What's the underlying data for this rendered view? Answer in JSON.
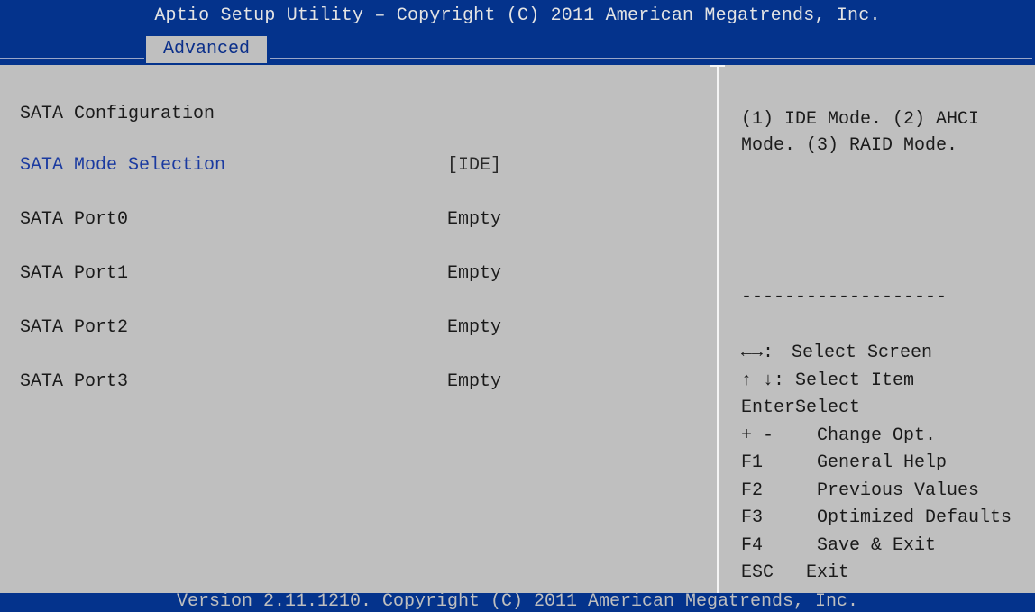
{
  "header": {
    "title": "Aptio Setup Utility – Copyright (C) 2011 American Megatrends, Inc.",
    "active_tab": "Advanced"
  },
  "main": {
    "section_title": "SATA Configuration",
    "rows": [
      {
        "label": "SATA Mode Selection",
        "value": "[IDE]",
        "selectable": true
      },
      {
        "label": "SATA Port0",
        "value": "Empty",
        "selectable": false
      },
      {
        "label": "SATA Port1",
        "value": "Empty",
        "selectable": false
      },
      {
        "label": "SATA Port2",
        "value": "Empty",
        "selectable": false
      },
      {
        "label": "SATA Port3",
        "value": "Empty",
        "selectable": false
      }
    ]
  },
  "help": {
    "text_line1": "(1) IDE Mode. (2) AHCI",
    "text_line2": "Mode. (3) RAID Mode.",
    "separator": "-------------------",
    "keys": [
      {
        "key": "←→:",
        "desc": "Select Screen"
      },
      {
        "key": "↑ ↓:",
        "desc": "Select Item"
      },
      {
        "key": "EnterSelect",
        "desc": ""
      },
      {
        "key": "+ -",
        "desc": "Change Opt."
      },
      {
        "key": "F1",
        "desc": "General Help"
      },
      {
        "key": "F2",
        "desc": "Previous Values"
      },
      {
        "key": "F3",
        "desc": "Optimized Defaults"
      },
      {
        "key": "F4",
        "desc": "Save & Exit"
      },
      {
        "key": "ESC",
        "desc": "Exit"
      }
    ]
  },
  "footer": {
    "version_text": "Version 2.11.1210. Copyright (C) 2011 American Megatrends, Inc."
  },
  "colors": {
    "header_bg": "#04338c",
    "panel_bg": "#bfbfbf",
    "highlight_text": "#1a3aa0"
  }
}
